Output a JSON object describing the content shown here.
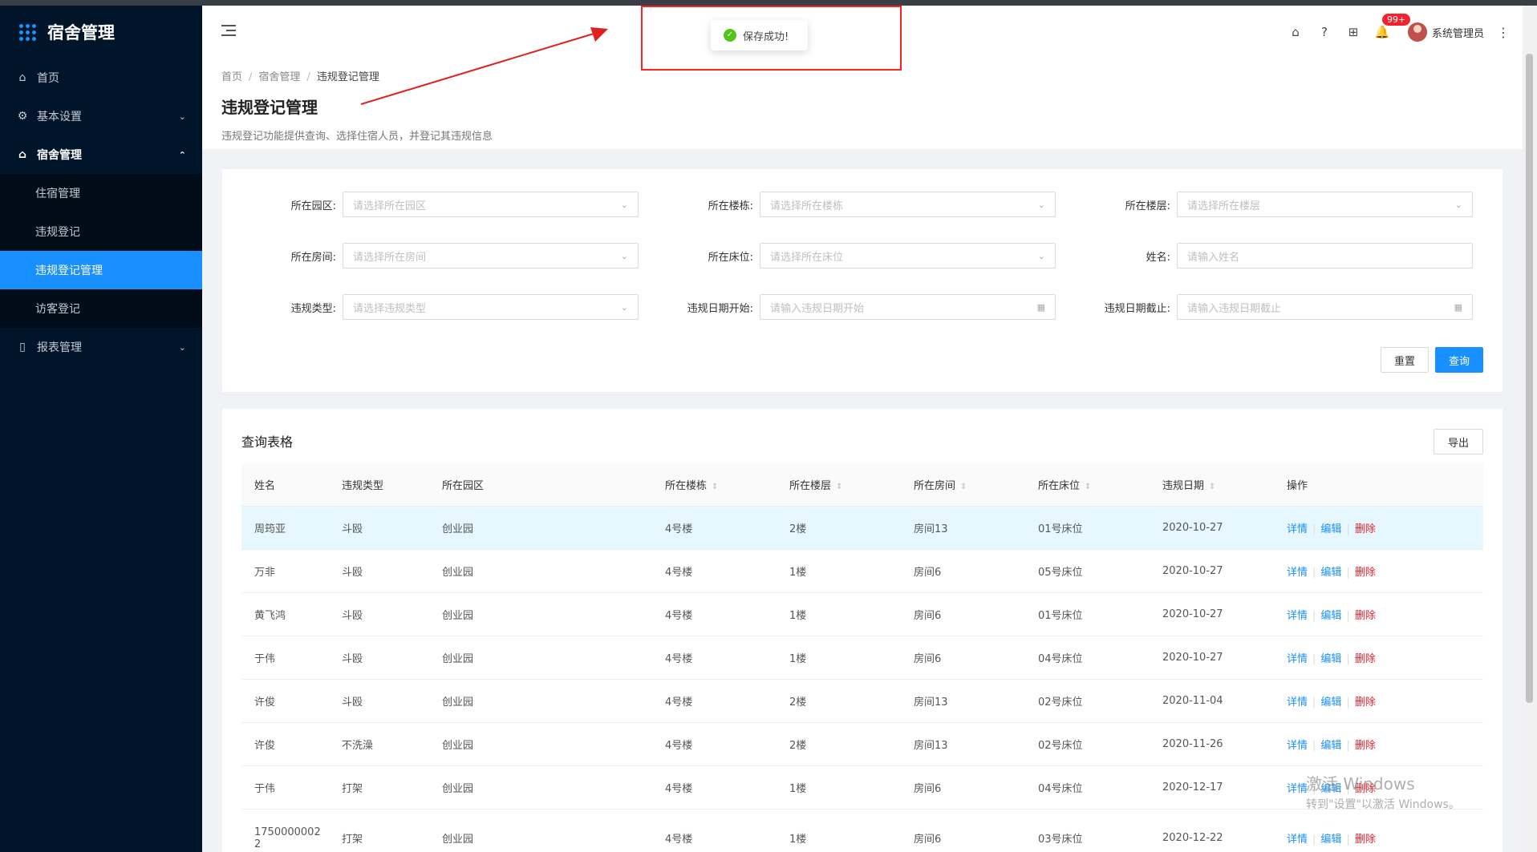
{
  "app": {
    "title": "宿舍管理"
  },
  "sidebar": {
    "items": [
      {
        "label": "首页",
        "icon": "home-icon"
      },
      {
        "label": "基本设置",
        "icon": "settings-icon"
      },
      {
        "label": "宿舍管理",
        "icon": "home-icon"
      },
      {
        "label": "报表管理",
        "icon": "report-icon"
      }
    ],
    "submenu": [
      "住宿管理",
      "违规登记",
      "违规登记管理",
      "访客登记"
    ]
  },
  "topbar": {
    "badge": "99+",
    "user": "系统管理员"
  },
  "toast": {
    "message": "保存成功!"
  },
  "header": {
    "breadcrumb": [
      "首页",
      "宿舍管理",
      "违规登记管理"
    ],
    "title": "违规登记管理",
    "desc": "违规登记功能提供查询、选择住宿人员，并登记其违规信息"
  },
  "filters": {
    "park": {
      "label": "所在园区:",
      "placeholder": "请选择所在园区"
    },
    "building": {
      "label": "所在楼栋:",
      "placeholder": "请选择所在楼栋"
    },
    "floor": {
      "label": "所在楼层:",
      "placeholder": "请选择所在楼层"
    },
    "room": {
      "label": "所在房间:",
      "placeholder": "请选择所在房间"
    },
    "bed": {
      "label": "所在床位:",
      "placeholder": "请选择所在床位"
    },
    "name": {
      "label": "姓名:",
      "placeholder": "请输入姓名"
    },
    "vtype": {
      "label": "违规类型:",
      "placeholder": "请选择违规类型"
    },
    "start": {
      "label": "违规日期开始:",
      "placeholder": "请输入违规日期开始"
    },
    "end": {
      "label": "违规日期截止:",
      "placeholder": "请输入违规日期截止"
    },
    "reset": "重置",
    "query": "查询"
  },
  "table": {
    "title": "查询表格",
    "export": "导出",
    "columns": [
      "姓名",
      "违规类型",
      "所在园区",
      "所在楼栋",
      "所在楼层",
      "所在房间",
      "所在床位",
      "违规日期",
      "操作"
    ],
    "actions": [
      "详情",
      "编辑",
      "删除"
    ],
    "rows": [
      [
        "周筠亚",
        "斗殴",
        "创业园",
        "4号楼",
        "2楼",
        "房间13",
        "01号床位",
        "2020-10-27"
      ],
      [
        "万非",
        "斗殴",
        "创业园",
        "4号楼",
        "1楼",
        "房间6",
        "05号床位",
        "2020-10-27"
      ],
      [
        "黄飞鸿",
        "斗殴",
        "创业园",
        "4号楼",
        "1楼",
        "房间6",
        "01号床位",
        "2020-10-27"
      ],
      [
        "于伟",
        "斗殴",
        "创业园",
        "4号楼",
        "1楼",
        "房间6",
        "04号床位",
        "2020-10-27"
      ],
      [
        "许俊",
        "斗殴",
        "创业园",
        "4号楼",
        "2楼",
        "房间13",
        "02号床位",
        "2020-11-04"
      ],
      [
        "许俊",
        "不洗澡",
        "创业园",
        "4号楼",
        "2楼",
        "房间13",
        "02号床位",
        "2020-11-26"
      ],
      [
        "于伟",
        "打架",
        "创业园",
        "4号楼",
        "1楼",
        "房间6",
        "04号床位",
        "2020-12-17"
      ],
      [
        "1750000002 2",
        "打架",
        "创业园",
        "4号楼",
        "1楼",
        "房间6",
        "03号床位",
        "2020-12-22"
      ]
    ]
  },
  "watermark": {
    "line1": "激活 Windows",
    "line2": "转到\"设置\"以激活 Windows。"
  }
}
